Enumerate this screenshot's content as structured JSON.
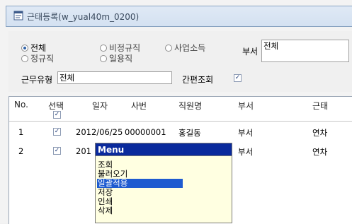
{
  "window": {
    "title": "근태등록(w_yual40m_0200)",
    "icon": "window-doc-icon"
  },
  "filters": {
    "employment": [
      {
        "label": "전체",
        "selected": true
      },
      {
        "label": "비정규직",
        "selected": false
      },
      {
        "label": "사업소득",
        "selected": false
      },
      {
        "label": "정규직",
        "selected": false
      },
      {
        "label": "일용직",
        "selected": false
      }
    ],
    "dept_label": "부서",
    "dept_value": "전체",
    "worktype_label": "근무유형",
    "worktype_value": "전체",
    "quick_label": "간편조회",
    "quick_checked": true
  },
  "grid": {
    "headers": [
      "No.",
      "선택",
      "일자",
      "사번",
      "직원명",
      "부서",
      "근태"
    ],
    "header_check": true,
    "rows": [
      {
        "no": "1",
        "checked": true,
        "date": "2012/06/25",
        "emp_id": "00000001",
        "name": "홍길동",
        "dept": "부서",
        "attendance": "연차"
      },
      {
        "no": "2",
        "checked": true,
        "date": "201",
        "emp_id": "",
        "name": "",
        "dept": "부서",
        "attendance": "연차"
      }
    ]
  },
  "context_menu": {
    "title": "Menu",
    "items": [
      "조회",
      "불러오기",
      "일괄적용",
      "저장",
      "인쇄",
      "삭제"
    ],
    "selected_index": 2
  },
  "colors": {
    "menu_title_bg": "#0a2a9c",
    "menu_bg": "#ffffe1",
    "selection": "#1e5bd0"
  }
}
